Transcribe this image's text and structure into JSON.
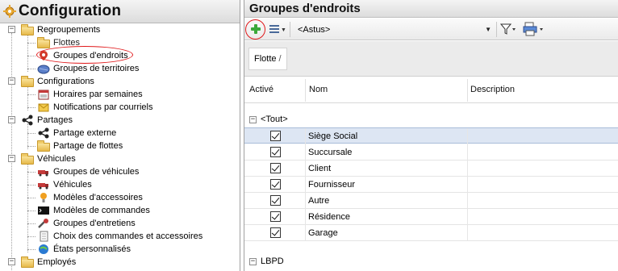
{
  "left_panel": {
    "title": "Configuration",
    "tree": [
      {
        "label": "Regroupements",
        "icon": "folder-icon"
      },
      {
        "label": "Flottes",
        "icon": "folder-icon"
      },
      {
        "label": "Groupes d'endroits",
        "icon": "location-pin-icon"
      },
      {
        "label": "Groupes de territoires",
        "icon": "globe-icon"
      },
      {
        "label": "Configurations",
        "icon": "folder-icon"
      },
      {
        "label": "Horaires par semaines",
        "icon": "calendar-icon"
      },
      {
        "label": "Notifications par courriels",
        "icon": "envelope-icon"
      },
      {
        "label": "Partages",
        "icon": "share-icon"
      },
      {
        "label": "Partage externe",
        "icon": "share-icon"
      },
      {
        "label": "Partage de flottes",
        "icon": "folder-share-icon"
      },
      {
        "label": "Véhicules",
        "icon": "folder-icon"
      },
      {
        "label": "Groupes de véhicules",
        "icon": "truck-icon"
      },
      {
        "label": "Véhicules",
        "icon": "truck-icon"
      },
      {
        "label": "Modèles d'accessoires",
        "icon": "lightbulb-icon"
      },
      {
        "label": "Modèles de commandes",
        "icon": "terminal-icon"
      },
      {
        "label": "Groupes d'entretiens",
        "icon": "wrench-icon"
      },
      {
        "label": "Choix des commandes et accessoires",
        "icon": "document-icon"
      },
      {
        "label": "États personnalisés",
        "icon": "status-globe-icon"
      },
      {
        "label": "Employés",
        "icon": "folder-icon"
      }
    ]
  },
  "right_panel": {
    "title": "Groupes d'endroits",
    "toolbar": {
      "combo_value": "<Astus>"
    },
    "breadcrumb": {
      "item": "Flotte",
      "separator": "/"
    },
    "columns": {
      "active": "Activé",
      "name": "Nom",
      "description": "Description"
    },
    "groups": [
      {
        "label": "<Tout>",
        "rows": [
          {
            "name": "Siège Social",
            "active": true,
            "selected": true
          },
          {
            "name": "Succursale",
            "active": true
          },
          {
            "name": "Client",
            "active": true
          },
          {
            "name": "Fournisseur",
            "active": true
          },
          {
            "name": "Autre",
            "active": true
          },
          {
            "name": "Résidence",
            "active": true
          },
          {
            "name": "Garage",
            "active": true
          }
        ]
      },
      {
        "label": "LBPD",
        "rows": []
      }
    ]
  },
  "colors": {
    "accent_green": "#3aa83a",
    "highlight_red": "#e0181a",
    "selection": "#dde6f3"
  }
}
